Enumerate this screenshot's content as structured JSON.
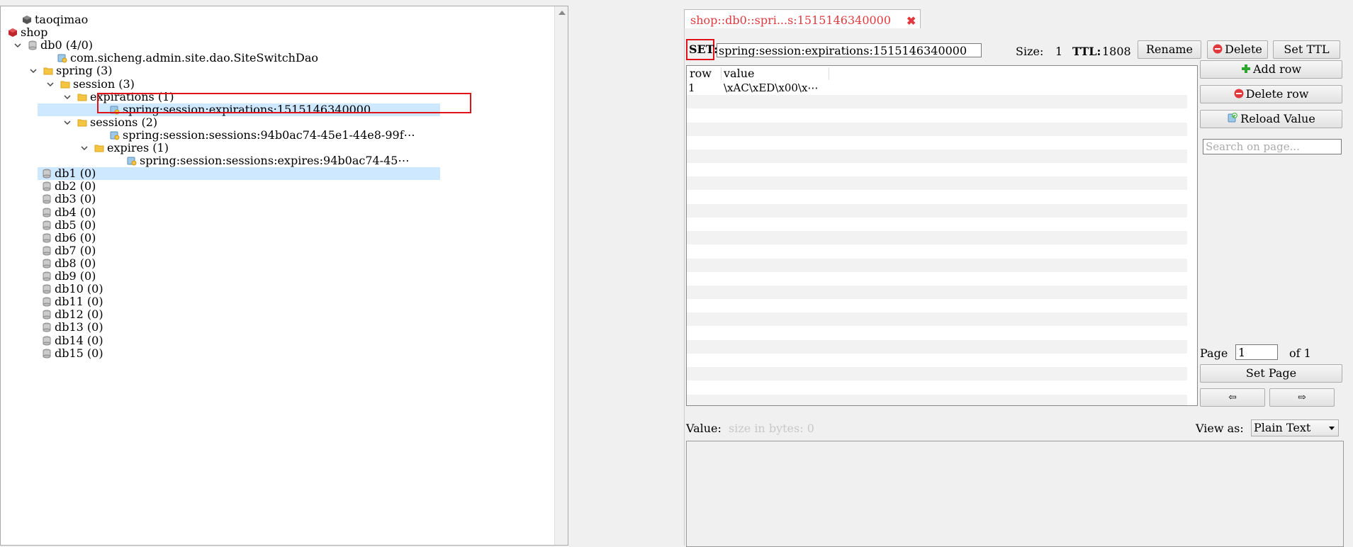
{
  "tree": {
    "items": [
      {
        "label": "taoqimao",
        "icon": "server-icon"
      },
      {
        "label": "shop",
        "icon": "server-icon"
      },
      {
        "label": "db0  (4/0)",
        "icon": "database-icon"
      },
      {
        "label": "com.sicheng.admin.site.dao.SiteSwitchDao",
        "icon": "key-icon"
      },
      {
        "label": "spring (3)",
        "icon": "folder-icon"
      },
      {
        "label": "session (3)",
        "icon": "folder-icon"
      },
      {
        "label": "expirations (1)",
        "icon": "folder-icon"
      },
      {
        "label": "spring:session:expirations:1515146340000",
        "icon": "key-icon"
      },
      {
        "label": "sessions (2)",
        "icon": "folder-icon"
      },
      {
        "label": "spring:session:sessions:94b0ac74-45e1-44e8-99f⋯",
        "icon": "key-icon"
      },
      {
        "label": "expires (1)",
        "icon": "folder-icon"
      },
      {
        "label": "spring:session:sessions:expires:94b0ac74-45⋯",
        "icon": "key-icon"
      },
      {
        "label": "db1 (0)",
        "icon": "database-icon"
      },
      {
        "label": "db2 (0)",
        "icon": "database-icon"
      },
      {
        "label": "db3 (0)",
        "icon": "database-icon"
      },
      {
        "label": "db4 (0)",
        "icon": "database-icon"
      },
      {
        "label": "db5 (0)",
        "icon": "database-icon"
      },
      {
        "label": "db6 (0)",
        "icon": "database-icon"
      },
      {
        "label": "db7 (0)",
        "icon": "database-icon"
      },
      {
        "label": "db8 (0)",
        "icon": "database-icon"
      },
      {
        "label": "db9 (0)",
        "icon": "database-icon"
      },
      {
        "label": "db10 (0)",
        "icon": "database-icon"
      },
      {
        "label": "db11 (0)",
        "icon": "database-icon"
      },
      {
        "label": "db12 (0)",
        "icon": "database-icon"
      },
      {
        "label": "db13 (0)",
        "icon": "database-icon"
      },
      {
        "label": "db14 (0)",
        "icon": "database-icon"
      },
      {
        "label": "db15 (0)",
        "icon": "database-icon"
      }
    ]
  },
  "tab": {
    "label": "shop::db0::spri...s:1515146340000",
    "close_icon": "close-icon"
  },
  "key": {
    "type_label": "SET:",
    "name": "spring:session:expirations:1515146340000",
    "size_label": "Size:",
    "size_value": "1",
    "ttl_label": "TTL:",
    "ttl_value": "1808"
  },
  "toolbar": {
    "rename": "Rename",
    "delete": "Delete",
    "set_ttl": "Set TTL"
  },
  "table": {
    "columns": [
      "row",
      "value"
    ],
    "rows": [
      {
        "row": "1",
        "value": "\\xAC\\xED\\x00\\x⋯"
      }
    ]
  },
  "side": {
    "add_row": "Add row",
    "delete_row": "Delete row",
    "reload_value": "Reload Value",
    "search_placeholder": "Search on page...",
    "page_label": "Page",
    "page_value": "1",
    "of_label": "of 1",
    "set_page": "Set Page",
    "prev": "⇦",
    "next": "⇨"
  },
  "value_editor": {
    "label": "Value:",
    "hint": "size in bytes: 0",
    "view_as_label": "View as:",
    "view_as_value": "Plain Text"
  },
  "colors": {
    "accent_red": "#e0131b",
    "selection": "#cde8ff",
    "folder": "#f5c542"
  }
}
